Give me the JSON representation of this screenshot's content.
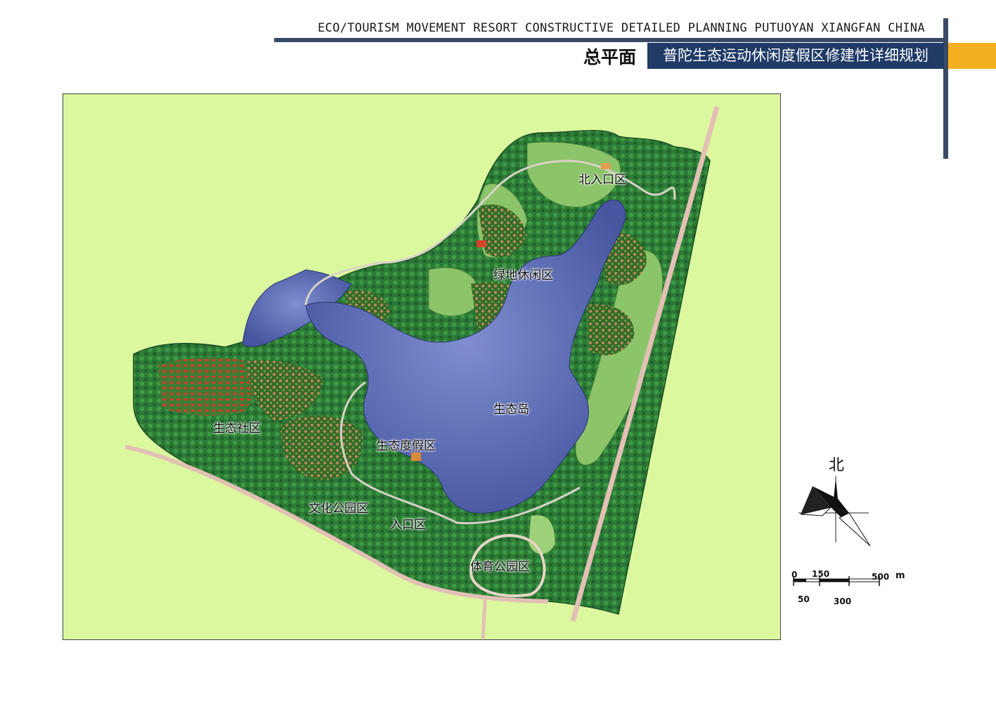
{
  "header": {
    "english_title": "ECO/TOURISM MOVEMENT RESORT CONSTRUCTIVE DETAILED PLANNING PUTUOYAN XIANGFAN CHINA",
    "drawing_name": "总平面",
    "project_title": "普陀生态运动休闲度假区修建性详细规划"
  },
  "colors": {
    "accent_navy": "#1f3b66",
    "rule": "#3a4a66",
    "accent_orange": "#f4b021",
    "background_land": "#dcf89e",
    "water": "#4f5fa3",
    "vegetation": "#2f7d3a",
    "lawn": "#8fc86a",
    "road": "#f1d3c6"
  },
  "map": {
    "zones": [
      {
        "id": "north-entrance",
        "label": "北入口区"
      },
      {
        "id": "green-leisure",
        "label": "绿地休闲区"
      },
      {
        "id": "eco-island",
        "label": "生态岛"
      },
      {
        "id": "eco-community",
        "label": "生态社区"
      },
      {
        "id": "eco-resort",
        "label": "生态度假区"
      },
      {
        "id": "culture-park",
        "label": "文化公园区"
      },
      {
        "id": "entrance",
        "label": "入口区"
      },
      {
        "id": "sports-park",
        "label": "体育公园区"
      }
    ]
  },
  "compass": {
    "label": "北",
    "icon": "north-arrow-icon"
  },
  "scale": {
    "top_labels": [
      "0",
      "150",
      "500"
    ],
    "bottom_labels": [
      "50",
      "300"
    ],
    "unit": "m"
  }
}
